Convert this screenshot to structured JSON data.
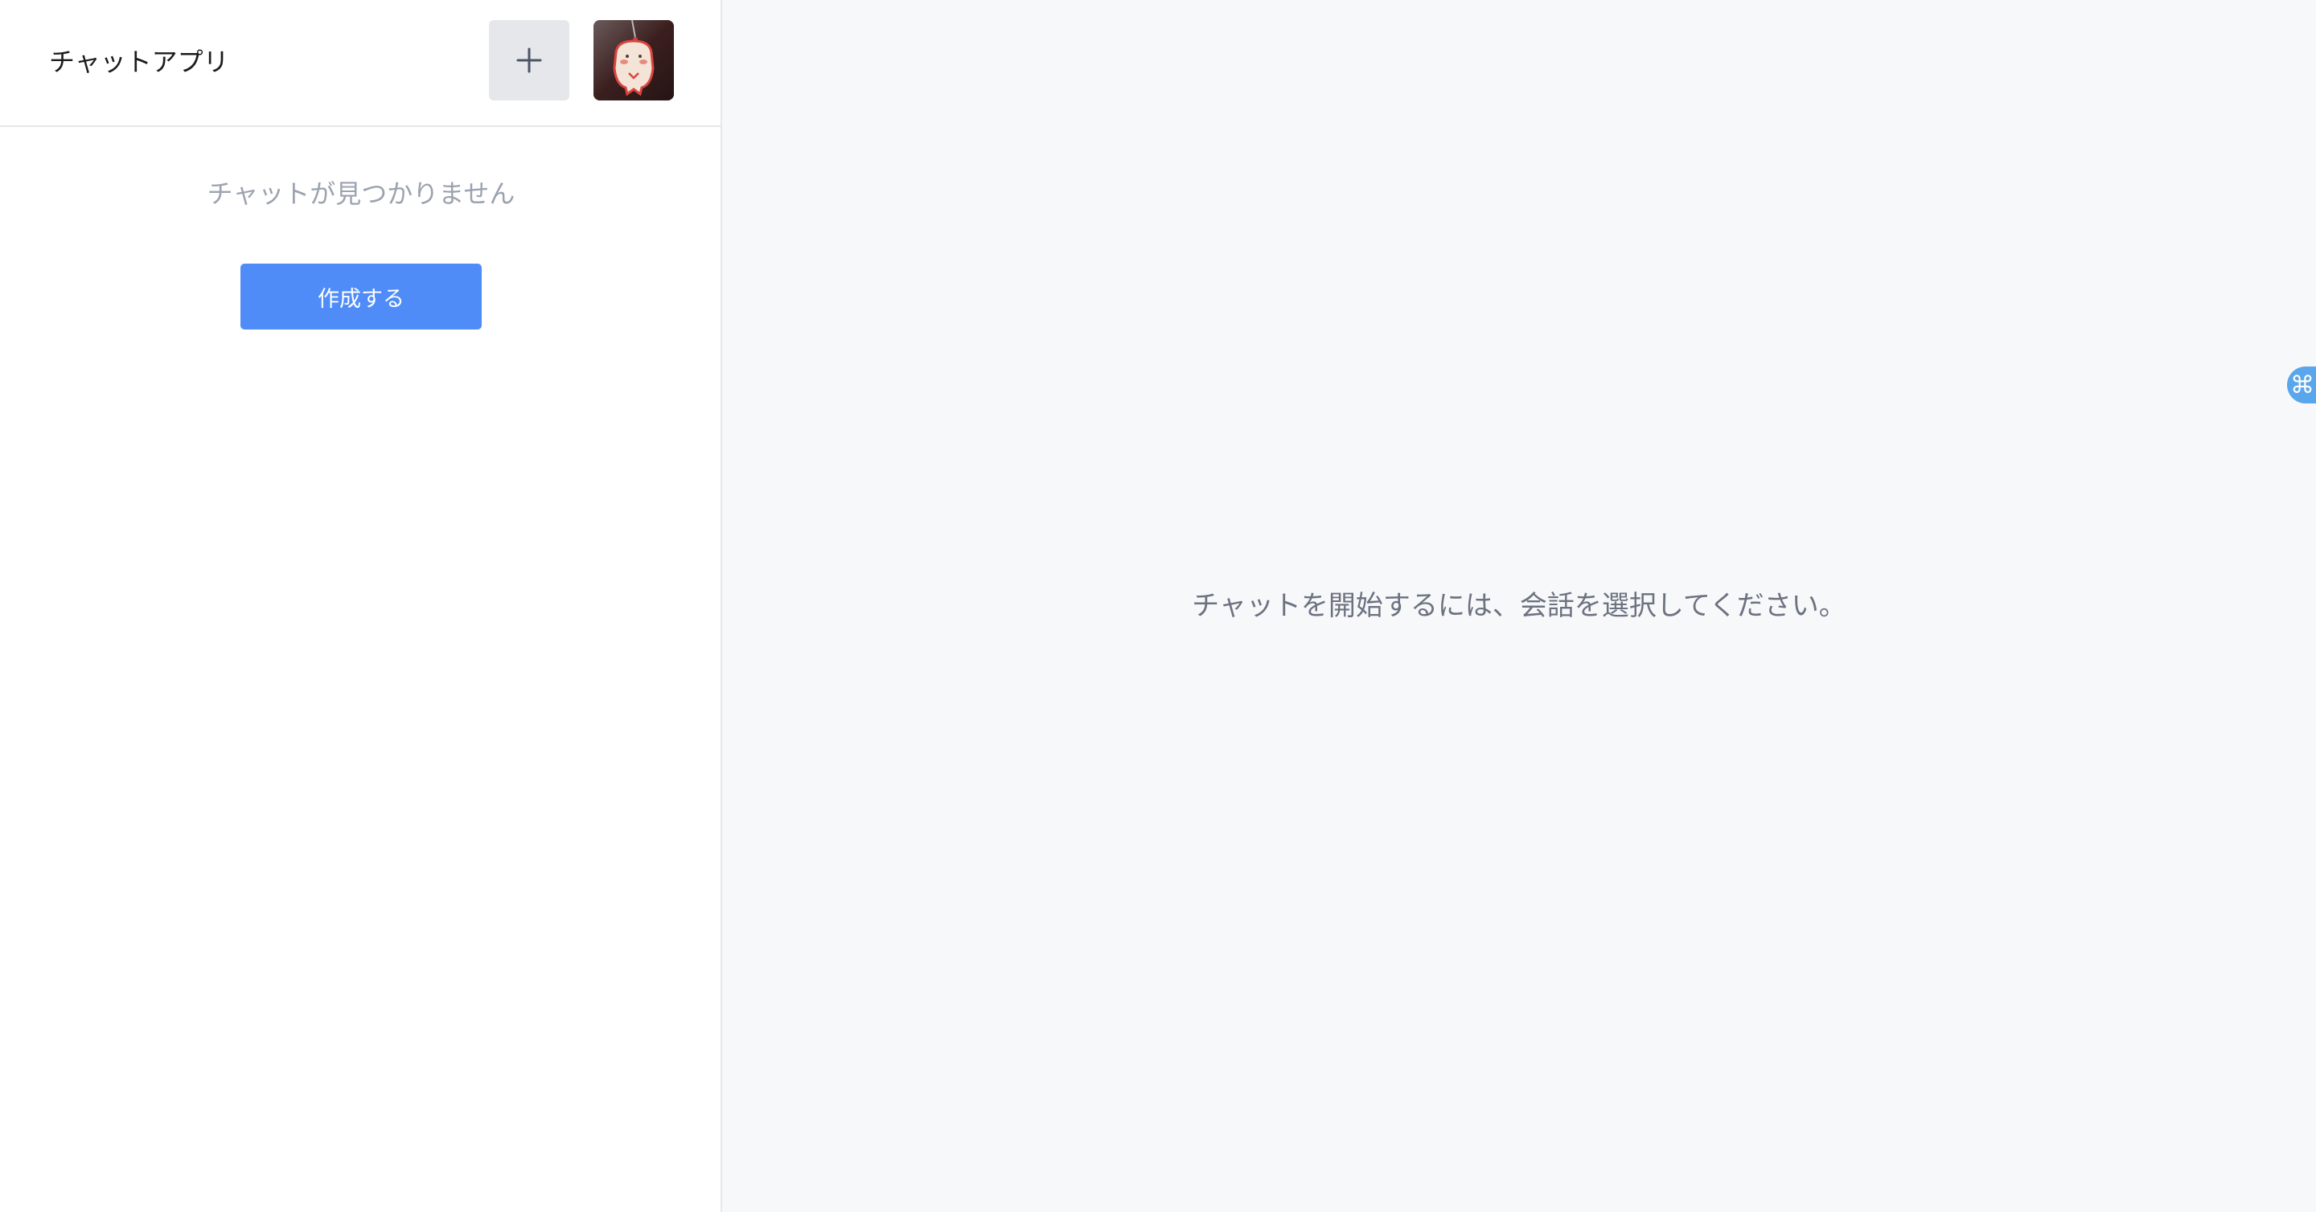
{
  "sidebar": {
    "title": "チャットアプリ",
    "new_chat_icon": "plus-icon",
    "avatar_icon": "user-avatar-photo",
    "empty_message": "チャットが見つかりません",
    "create_button_label": "作成する"
  },
  "main": {
    "placeholder": "チャットを開始するには、会話を選択してください。"
  },
  "overlay": {
    "shortcut_glyph": "⌘",
    "shortcut_icon": "command-key-icon"
  },
  "colors": {
    "primary": "#4f8cf7",
    "sidebar_bg": "#ffffff",
    "main_bg": "#f7f8fa",
    "muted_text": "#9ca3af",
    "placeholder_text": "#6b7280",
    "shortcut_handle": "#5aa6ec"
  }
}
